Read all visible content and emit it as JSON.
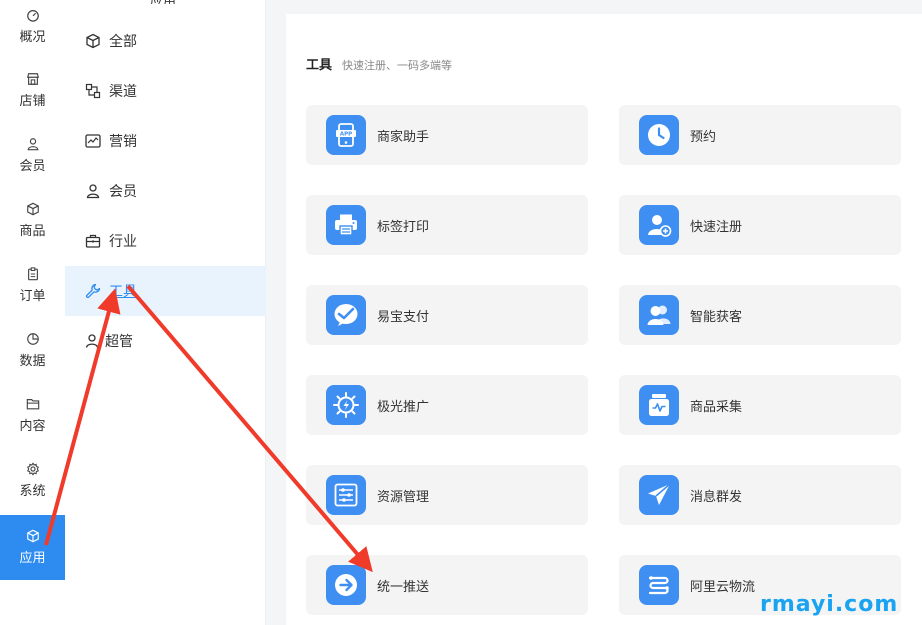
{
  "nav_primary": [
    {
      "label": "概况",
      "icon": "dashboard-icon"
    },
    {
      "label": "店铺",
      "icon": "store-icon"
    },
    {
      "label": "会员",
      "icon": "user-icon"
    },
    {
      "label": "商品",
      "icon": "box-icon"
    },
    {
      "label": "订单",
      "icon": "clipboard-icon"
    },
    {
      "label": "数据",
      "icon": "pie-icon"
    },
    {
      "label": "内容",
      "icon": "folder-icon"
    },
    {
      "label": "系统",
      "icon": "gear-icon"
    },
    {
      "label": "应用",
      "icon": "cube-icon",
      "active": true
    }
  ],
  "nav_secondary": {
    "cut_label": "应用",
    "items": [
      {
        "label": "全部",
        "icon": "cube-icon"
      },
      {
        "label": "渠道",
        "icon": "channel-icon"
      },
      {
        "label": "营销",
        "icon": "chart-icon"
      },
      {
        "label": "会员",
        "icon": "user-icon"
      },
      {
        "label": "行业",
        "icon": "briefcase-icon"
      },
      {
        "label": "工具",
        "icon": "wrench-icon",
        "active": true
      },
      {
        "label": "超管",
        "icon": "admin-icon"
      }
    ]
  },
  "content": {
    "title": "工具",
    "subtitle": "快速注册、一码多端等",
    "cards": [
      {
        "label": "商家助手",
        "icon": "app-phone-icon"
      },
      {
        "label": "预约",
        "icon": "clock-icon"
      },
      {
        "label": "标签打印",
        "icon": "printer-icon"
      },
      {
        "label": "快速注册",
        "icon": "add-user-icon"
      },
      {
        "label": "易宝支付",
        "icon": "payment-icon"
      },
      {
        "label": "智能获客",
        "icon": "users-icon"
      },
      {
        "label": "极光推广",
        "icon": "aurora-icon"
      },
      {
        "label": "商品采集",
        "icon": "collect-icon"
      },
      {
        "label": "资源管理",
        "icon": "sliders-icon"
      },
      {
        "label": "消息群发",
        "icon": "paper-plane-icon"
      },
      {
        "label": "统一推送",
        "icon": "arrow-right-icon"
      },
      {
        "label": "阿里云物流",
        "icon": "logistics-icon"
      }
    ]
  },
  "watermark": "rmayi.com",
  "colors": {
    "accent": "#2e8cf0",
    "arrow": "#f03b2b",
    "card_bg": "#f4f4f4",
    "icon_bg": "#3f8ff2"
  }
}
